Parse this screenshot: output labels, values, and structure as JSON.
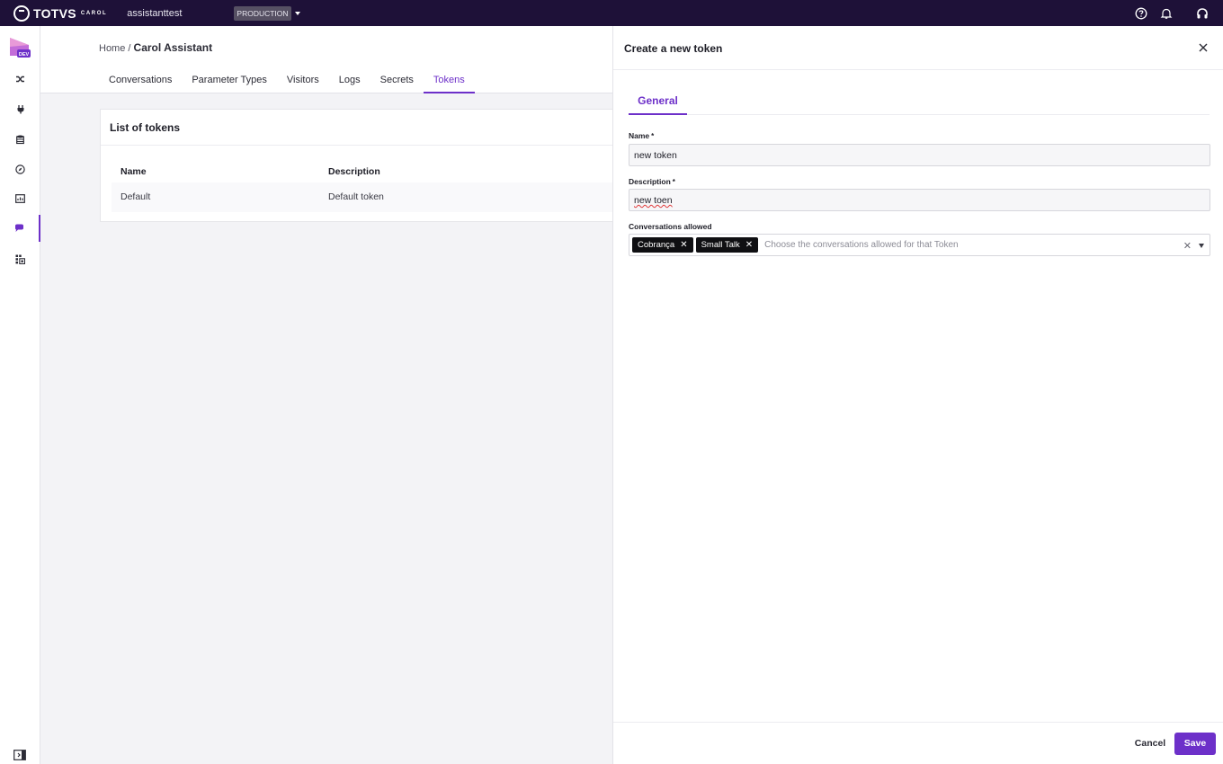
{
  "topbar": {
    "brand": "TOTVS",
    "brand_sub": "CAROL",
    "tenant": "assistanttest",
    "environment": "PRODUCTION",
    "icons": [
      "help-icon",
      "bell-icon",
      "headset-icon"
    ]
  },
  "rail": {
    "logo_badge": "DEV",
    "items": [
      "shuffle-icon",
      "plug-icon",
      "database-icon",
      "compass-icon",
      "chart-icon",
      "chat-icon",
      "apps-icon"
    ],
    "active_item": "chat-icon",
    "bottom_icon": "collapse-sidebar-icon"
  },
  "breadcrumb": {
    "home": "Home",
    "separator": "/",
    "current": "Carol Assistant"
  },
  "tabs": [
    "Conversations",
    "Parameter Types",
    "Visitors",
    "Logs",
    "Secrets",
    "Tokens"
  ],
  "active_tab": "Tokens",
  "tokens_card": {
    "title": "List of tokens",
    "columns": [
      "Name",
      "Description"
    ],
    "rows": [
      {
        "name": "Default",
        "description": "Default token"
      }
    ]
  },
  "drawer": {
    "title": "Create a new token",
    "tab": "General",
    "name_label": "Name",
    "name_value": "new token",
    "description_label": "Description",
    "description_value": "new toen",
    "conversations_label": "Conversations allowed",
    "conversations_selected": [
      "Cobrança",
      "Small Talk"
    ],
    "conversations_placeholder": "Choose the conversations allowed for that Token",
    "required_mark": "*",
    "cancel_label": "Cancel",
    "save_label": "Save"
  },
  "colors": {
    "accent": "#6d30c9",
    "topbar": "#1e1138"
  }
}
